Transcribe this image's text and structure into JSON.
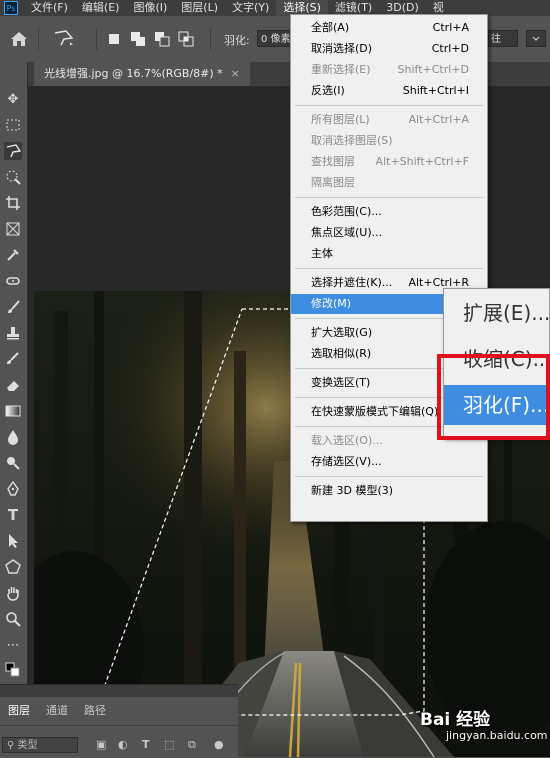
{
  "app": {
    "name": "Ps"
  },
  "menubar": [
    {
      "label": "文件(F)"
    },
    {
      "label": "编辑(E)"
    },
    {
      "label": "图像(I)"
    },
    {
      "label": "图层(L)"
    },
    {
      "label": "文字(Y)"
    },
    {
      "label": "选择(S)",
      "active": true
    },
    {
      "label": "滤镜(T)"
    },
    {
      "label": "3D(D)"
    },
    {
      "label": "视"
    }
  ],
  "options": {
    "feather_label": "羽化:",
    "feather_value": "0 像素",
    "right_field": "往"
  },
  "document": {
    "tab_title": "光线增强.jpg @ 16.7%(RGB/8#) *",
    "close": "×"
  },
  "select_menu": [
    {
      "label": "全部(A)",
      "shortcut": "Ctrl+A"
    },
    {
      "label": "取消选择(D)",
      "shortcut": "Ctrl+D"
    },
    {
      "label": "重新选择(E)",
      "shortcut": "Shift+Ctrl+D",
      "disabled": true
    },
    {
      "label": "反选(I)",
      "shortcut": "Shift+Ctrl+I"
    },
    {
      "sep": true
    },
    {
      "label": "所有图层(L)",
      "shortcut": "Alt+Ctrl+A",
      "disabled": true
    },
    {
      "label": "取消选择图层(S)",
      "shortcut": "",
      "disabled": true
    },
    {
      "label": "查找图层",
      "shortcut": "Alt+Shift+Ctrl+F",
      "disabled": true
    },
    {
      "label": "隔离图层",
      "shortcut": "",
      "disabled": true
    },
    {
      "sep": true
    },
    {
      "label": "色彩范围(C)...",
      "shortcut": ""
    },
    {
      "label": "焦点区域(U)...",
      "shortcut": ""
    },
    {
      "label": "主体",
      "shortcut": ""
    },
    {
      "sep": true
    },
    {
      "label": "选择并遮住(K)...",
      "shortcut": "Alt+Ctrl+R"
    },
    {
      "label": "修改(M)",
      "shortcut": "",
      "highlighted": true,
      "submenu": true
    },
    {
      "sep": true
    },
    {
      "label": "扩大选取(G)",
      "shortcut": ""
    },
    {
      "label": "选取相似(R)",
      "shortcut": ""
    },
    {
      "sep": true
    },
    {
      "label": "变换选区(T)",
      "shortcut": ""
    },
    {
      "sep": true
    },
    {
      "label": "在快速蒙版模式下编辑(Q)",
      "shortcut": ""
    },
    {
      "sep": true
    },
    {
      "label": "载入选区(O)...",
      "shortcut": "",
      "disabled": true
    },
    {
      "label": "存储选区(V)...",
      "shortcut": ""
    },
    {
      "sep": true
    },
    {
      "label": "新建 3D 模型(3)",
      "shortcut": ""
    }
  ],
  "modify_submenu": [
    {
      "label": "扩展(E)..."
    },
    {
      "label": "收缩(C)..."
    },
    {
      "label": "羽化(F)...",
      "highlighted": true
    }
  ],
  "layers_panel": {
    "tabs": [
      "图层",
      "通道",
      "路径"
    ],
    "filter": "类型"
  },
  "watermark": {
    "logo": "Bai 经验",
    "url": "jingyan.baidu.com"
  },
  "colors": {
    "highlight": "#3e8de0",
    "annotation": "#e1101c"
  }
}
